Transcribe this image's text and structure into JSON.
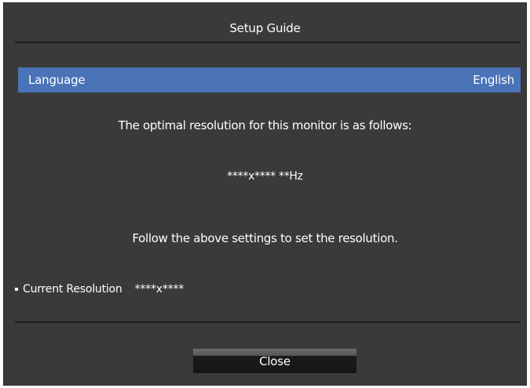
{
  "dialog": {
    "title": "Setup Guide",
    "language_label": "Language",
    "language_value": "English",
    "optimal_message": "The optimal resolution for this monitor is as follows:",
    "optimal_resolution": "****x**** **Hz",
    "instruction": "Follow the above settings to set the resolution.",
    "current_label": "Current Resolution",
    "current_value": "****x****",
    "close_label": "Close"
  },
  "colors": {
    "background": "#3a3a3a",
    "highlight": "#4a73b8",
    "text": "#ffffff"
  }
}
